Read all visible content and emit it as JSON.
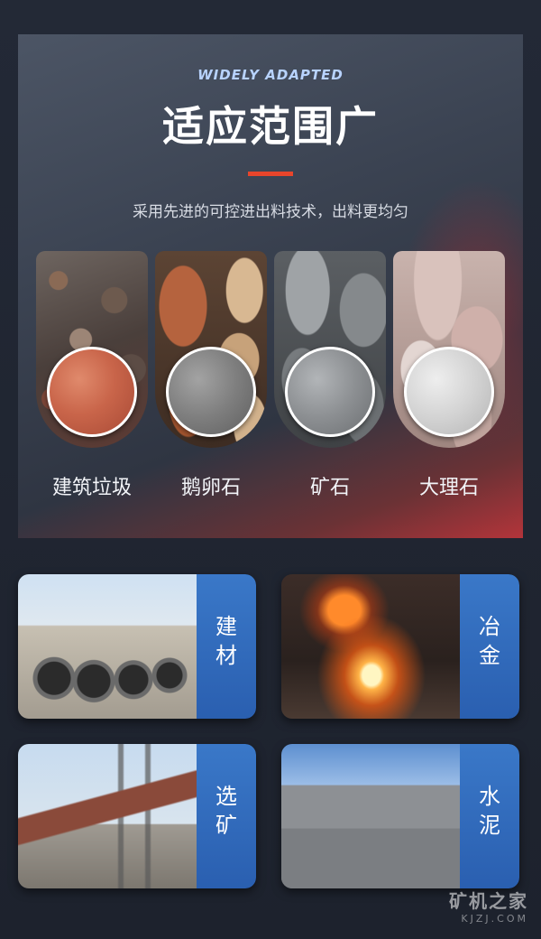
{
  "hero": {
    "eyebrow": "WIDELY ADAPTED",
    "title": "适应范围广",
    "subtitle": "采用先进的可控进出料技术，出料更均匀"
  },
  "materials": [
    {
      "label": "建筑垃圾",
      "photo": "construction-waste-photo",
      "sample": "red-aggregate-sample"
    },
    {
      "label": "鹅卵石",
      "photo": "pebbles-photo",
      "sample": "grey-gravel-sample"
    },
    {
      "label": "矿石",
      "photo": "ore-photo",
      "sample": "grey-ore-sample"
    },
    {
      "label": "大理石",
      "photo": "marble-photo",
      "sample": "white-chips-sample"
    }
  ],
  "applications": [
    {
      "label": "建材",
      "photo": "building-pipes-photo"
    },
    {
      "label": "冶金",
      "photo": "molten-metal-photo"
    },
    {
      "label": "选矿",
      "photo": "rotary-kiln-photo"
    },
    {
      "label": "水泥",
      "photo": "cement-blocks-photo"
    }
  ],
  "watermark": {
    "cn": "矿机之家",
    "en": "KJZJ.COM"
  },
  "colors": {
    "accent_bar": "#e8452b",
    "tab_blue": "#3a78c8",
    "eyebrow": "#b8d3ff"
  }
}
